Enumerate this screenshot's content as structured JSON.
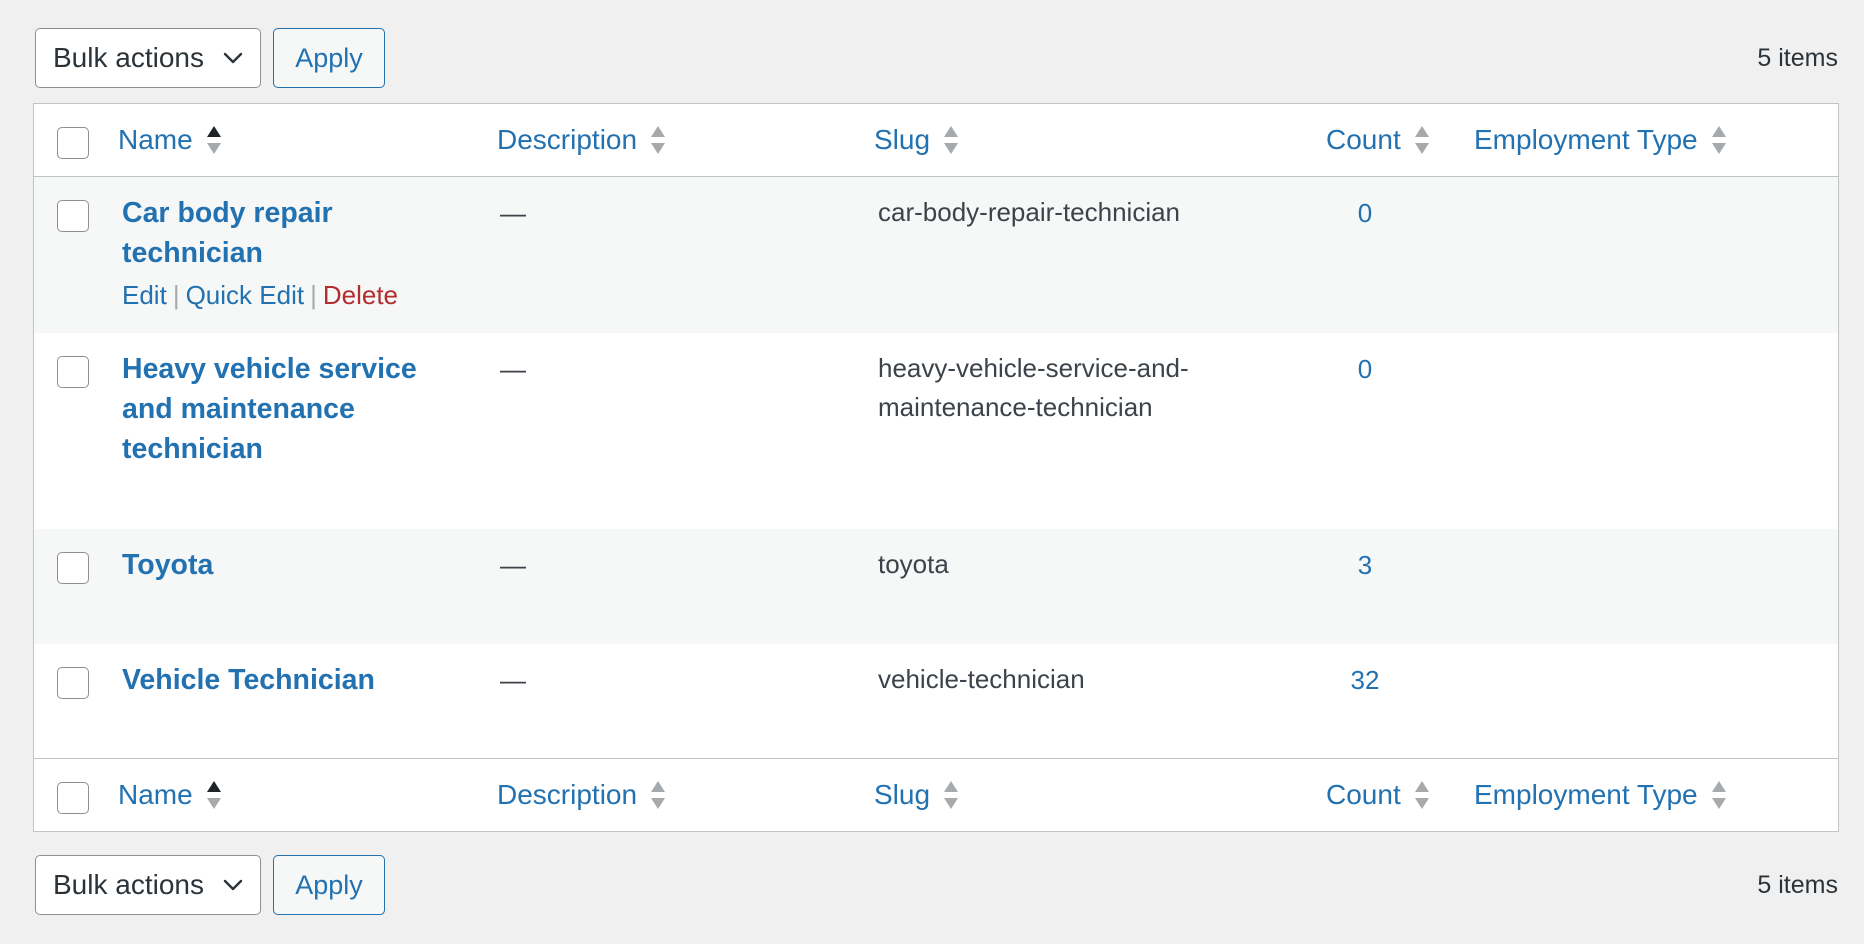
{
  "toolbar": {
    "bulk_label": "Bulk actions",
    "apply_label": "Apply",
    "items_count": "5 items"
  },
  "columns": {
    "name": "Name",
    "description": "Description",
    "slug": "Slug",
    "count": "Count",
    "employment_type": "Employment Type"
  },
  "rows": [
    {
      "name_line1": "Car body repair",
      "name_line2": "technician",
      "description": "—",
      "slug": "car-body-repair-technician",
      "count": "0"
    },
    {
      "name_line1": "Heavy vehicle service",
      "name_line2": "and maintenance",
      "name_line3": "technician",
      "description": "—",
      "slug_line1": "heavy-vehicle-service-and-",
      "slug_line2": "maintenance-technician",
      "count": "0"
    },
    {
      "name": "Toyota",
      "description": "—",
      "slug": "toyota",
      "count": "3"
    },
    {
      "name": "Vehicle Technician",
      "description": "—",
      "slug": "vehicle-technician",
      "count": "32"
    }
  ],
  "row_actions": {
    "edit": "Edit",
    "quick_edit": "Quick Edit",
    "delete": "Delete",
    "separator": "|"
  },
  "colors": {
    "link": "#2271b1",
    "delete": "#b32d2e",
    "alt_row": "#f6f7f7",
    "background": "#f0f0f1"
  }
}
